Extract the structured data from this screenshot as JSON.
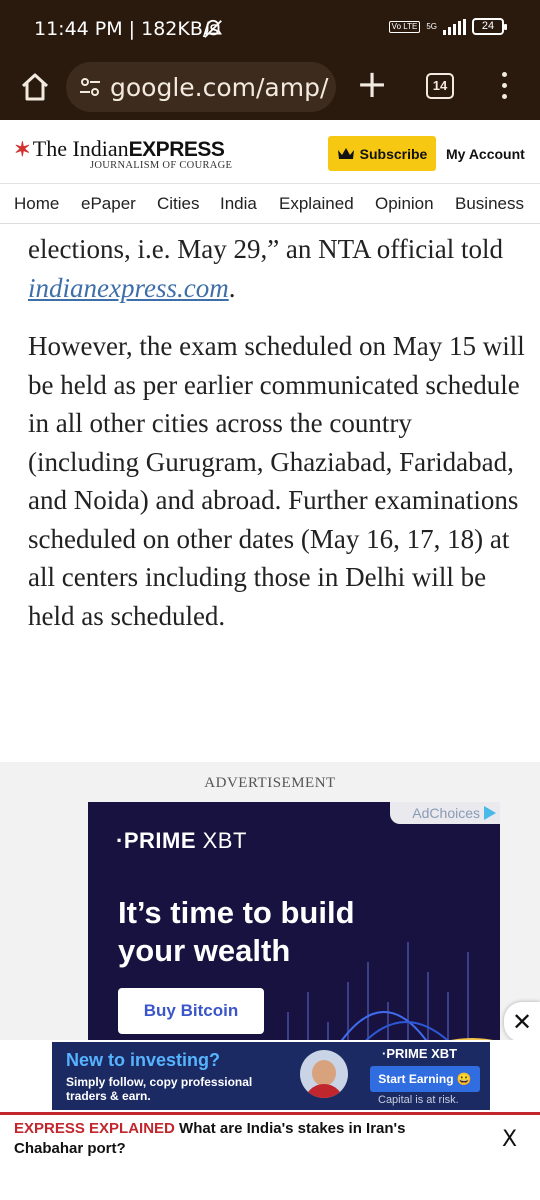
{
  "status_bar": {
    "time_speed": "11:44 PM | 182KB/s",
    "volte": "Vo LTE",
    "network": "5G",
    "battery": "24",
    "icons": [
      "mute-icon",
      "signal-icon",
      "battery-icon"
    ]
  },
  "browser": {
    "url": "google.com/amp/",
    "tab_count": "14",
    "icons": [
      "home-icon",
      "tune-icon",
      "plus-icon",
      "tabs-icon",
      "menu-icon"
    ]
  },
  "site": {
    "logo_the_indian": "The Indian",
    "logo_express": "EXPRESS",
    "tagline": "JOURNALISM OF COURAGE",
    "subscribe": "Subscribe",
    "account": "My Account",
    "brand_color": "#f6c812"
  },
  "nav": {
    "items": [
      "Home",
      "ePaper",
      "Cities",
      "India",
      "Explained",
      "Opinion",
      "Business"
    ]
  },
  "article": {
    "p1_start": "elections, i.e. May 29,” an NTA official told ",
    "p1_link": "indianexpress.com",
    "p1_end": ".",
    "p2": "However, the exam scheduled on May 15 will be held as per earlier communicated schedule in all other cities across the country (including Gurugram, Ghaziabad, Faridabad, and Noida) and abroad. Further examinations scheduled on other dates (May 16, 17, 18) at all centers including those in Delhi will be held as scheduled."
  },
  "ad": {
    "label": "ADVERTISEMENT",
    "adchoices": "AdChoices",
    "brand_prime": "·PRIME",
    "brand_xbt": "XBT",
    "headline": "It’s time to build your wealth",
    "cta": "Buy Bitcoin",
    "close": "✕"
  },
  "anchor_ad": {
    "title": "New to investing?",
    "subtitle": "Simply follow, copy professional traders & earn.",
    "brand": "·PRIME XBT",
    "button": "Start Earning 😀",
    "risk": "Capital is at risk."
  },
  "explained": {
    "tag": "EXPRESS EXPLAINED",
    "headline": " What are India's stakes in Iran's Chabahar port?",
    "close": "X"
  }
}
